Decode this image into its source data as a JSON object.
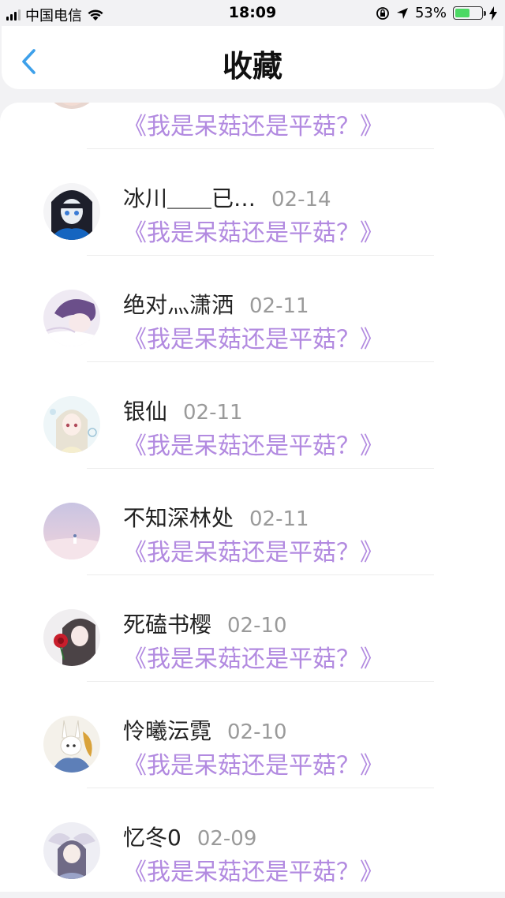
{
  "status_bar": {
    "carrier": "中国电信",
    "time": "18:09",
    "battery_percent": "53%",
    "battery_level": 0.53
  },
  "header": {
    "title": "收藏"
  },
  "colors": {
    "accent_purple": "#b28ae0",
    "back_blue": "#3da0ea",
    "battery_green": "#4cd964"
  },
  "favorites": [
    {
      "name": "",
      "date": "",
      "title": "《我是呆菇还是平菇？》",
      "avatar": "avatar-girl-brown"
    },
    {
      "name": "冰川＿＿已…",
      "date": "02-14",
      "title": "《我是呆菇还是平菇？》",
      "avatar": "avatar-girl-dark"
    },
    {
      "name": "绝对灬潇洒",
      "date": "02-11",
      "title": "《我是呆菇还是平菇？》",
      "avatar": "avatar-boy-purple"
    },
    {
      "name": "银仙",
      "date": "02-11",
      "title": "《我是呆菇还是平菇？》",
      "avatar": "avatar-girl-white"
    },
    {
      "name": "不知深林处",
      "date": "02-11",
      "title": "《我是呆菇还是平菇？》",
      "avatar": "avatar-sky-pink"
    },
    {
      "name": "死磕书樱",
      "date": "02-10",
      "title": "《我是呆菇还是平菇？》",
      "avatar": "avatar-girl-rose"
    },
    {
      "name": "怜曦沄霓",
      "date": "02-10",
      "title": "《我是呆菇还是平菇？》",
      "avatar": "avatar-bunny-gold"
    },
    {
      "name": "忆冬0",
      "date": "02-09",
      "title": "《我是呆菇还是平菇？》",
      "avatar": "avatar-girl-bunny"
    }
  ]
}
